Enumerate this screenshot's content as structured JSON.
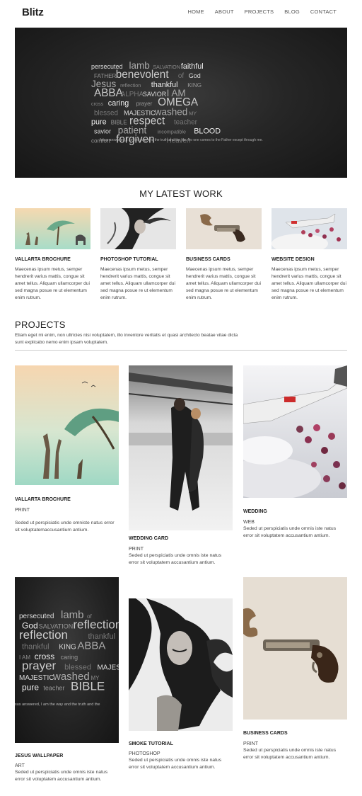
{
  "brand": "Blitz",
  "nav": [
    "HOME",
    "ABOUT",
    "PROJECTS",
    "BLOG",
    "CONTACT"
  ],
  "hero": {
    "words": [
      "persecuted",
      "lamb",
      "SALVATION",
      "faithful",
      "FATHER",
      "benevolent",
      "of",
      "God",
      "Jesus",
      "reflection",
      "thankful",
      "KING",
      "ABBA",
      "ALPHA",
      "SAVIOR",
      "I AM",
      "cross",
      "caring",
      "prayer",
      "OMEGA",
      "blessed",
      "MAJESTIC",
      "washed",
      "MY",
      "pure",
      "BIBLE",
      "respect",
      "teacher",
      "savior",
      "patient",
      "incompatible",
      "BLOOD",
      "comfort",
      "forgiven",
      "Heaven"
    ],
    "quote": "Jesus answered,   I am the way and the truth and the life. No one comes to the Father except through me."
  },
  "latest": {
    "title": "MY LATEST WORK",
    "items": [
      {
        "title": "VALLARTA BROCHURE",
        "text": "Maecenas ipsum metus, semper hendrerit varius mattis, congue sit amet tellus. Aliquam ullamcorper dui sed magna posue re ut elementum enim rutrum."
      },
      {
        "title": "PHOTOSHOP TUTORIAL",
        "text": "Maecenas ipsum metus, semper hendrerit varius mattis, congue sit amet tellus. Aliquam ullamcorper dui sed magna posue re ut elementum enim rutrum."
      },
      {
        "title": "BUSINESS CARDS",
        "text": "Maecenas ipsum metus, semper hendrerit varius mattis, congue sit amet tellus. Aliquam ullamcorper dui sed magna posue re ut elementum enim rutrum."
      },
      {
        "title": "WEBSITE DESIGN",
        "text": "Maecenas ipsum metus, semper hendrerit varius mattis, congue sit amet tellus. Aliquam ullamcorper dui sed magna posue re ut elementum enim rutrum."
      }
    ]
  },
  "projects": {
    "title": "PROJECTS",
    "description": "Etiam eget mi enim, non ultricies nisi voluptatem, illo inventore veritatis et quasi architecto beatae  vitae dicta sunt explicabo nemo enim ipsam voluptatem.",
    "items": [
      {
        "title": "VALLARTA BROCHURE",
        "category": "PRINT",
        "text": "Seded ut perspiciatis unde omniste natus error sit voluptatemaccusantium antium."
      },
      {
        "title": "WEDDING CARD",
        "category": "PRINT",
        "text": "Seded ut perspiciatis unde omnis iste natus error sit voluptatem accusantium antium."
      },
      {
        "title": "WEDDING",
        "category": "WEB",
        "text": "Seded ut perspiciatis unde omnis iste natus error sit voluptatem accusantium antium."
      },
      {
        "title": "JESUS WALLPAPER",
        "category": "ART",
        "text": "Seded ut perspiciatis unde omnis iste natus error sit voluptatem accusantium antium."
      },
      {
        "title": "SMOKE TUTORIAL",
        "category": "PHOTOSHOP",
        "text": "Seded ut perspiciatis unde omnis iste natus error sit voluptatem accusantium antium."
      },
      {
        "title": "BUSINESS CARDS",
        "category": "PRINT",
        "text": "Seded ut perspiciatis unde omnis iste natus error sit voluptatem accusantium antium."
      }
    ],
    "wallpaper_words": [
      "persecuted",
      "lamb",
      "of",
      "God",
      "SALVATION",
      "reflection",
      "thankful",
      "KING",
      "ABBA",
      "I AM",
      "cross",
      "caring",
      "prayer",
      "blessed",
      "MAJESTIC",
      "washed",
      "MY",
      "pure",
      "teacher",
      "BIBLE",
      "respect"
    ],
    "wallpaper_quote": "sus answered,    I am the way and the truth and the"
  },
  "colors": {
    "dark": "#1c1c1c",
    "mint": "#bfe3d0",
    "peach": "#f0d6b8",
    "beige": "#e6ded3"
  }
}
